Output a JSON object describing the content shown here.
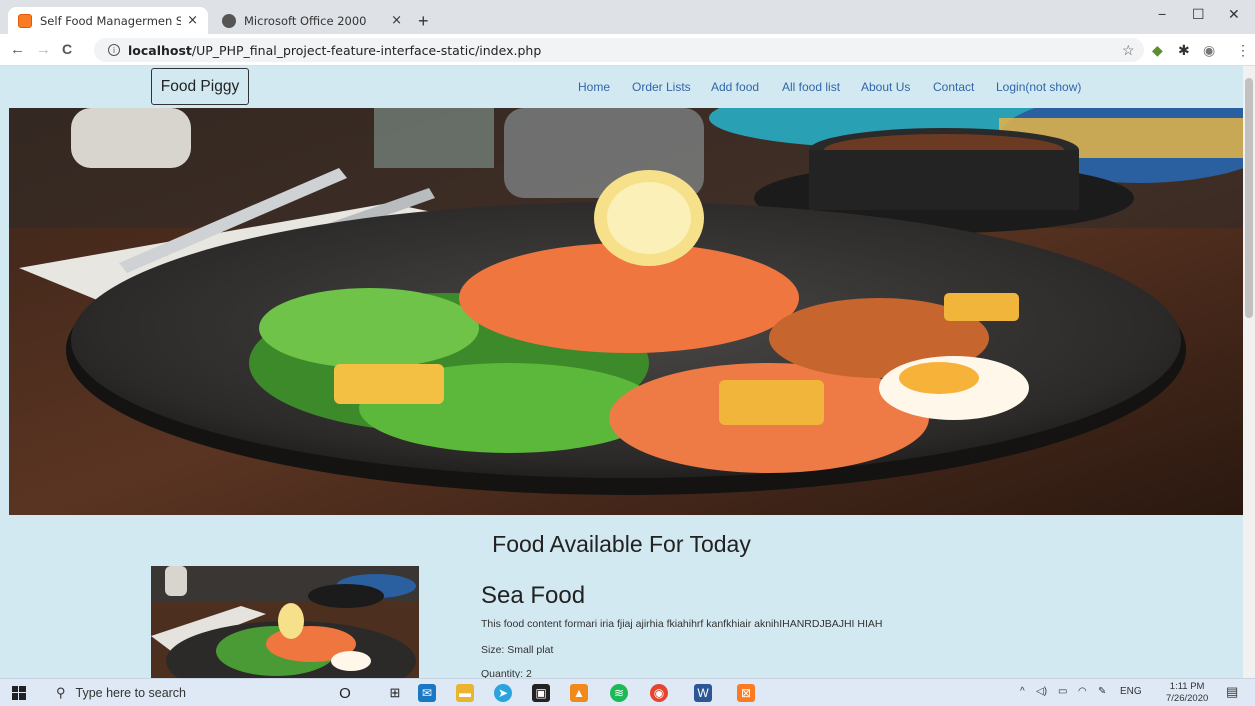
{
  "browser": {
    "tabs": [
      {
        "title": "Self Food Managermen System",
        "close": "×"
      },
      {
        "title": "Microsoft Office 2000",
        "close": "×"
      }
    ],
    "new_tab": "+",
    "window_controls": {
      "minimize": "−",
      "maximize": "☐",
      "close": "✕"
    },
    "nav": {
      "back": "←",
      "forward": "→",
      "reload": "C"
    },
    "url_host": "localhost",
    "url_path": "/UP_PHP_final_project-feature-interface-static/index.php",
    "info_icon": "i"
  },
  "site": {
    "brand": "Food Piggy",
    "nav": [
      "Home",
      "Order Lists",
      "Add food",
      "All food list",
      "About Us",
      "Contact",
      "Login(not show)"
    ],
    "section_title": "Food Available For Today",
    "food": {
      "name": "Sea Food",
      "description": "This food content formari iria fjiaj ajirhia fkiahihrf kanfkhiair aknihIHANRDJBAJHI HIAH",
      "size": "Size: Small plat",
      "quantity": "Quantity: 2"
    }
  },
  "taskbar": {
    "search_placeholder": "Type here to search",
    "tray_lang": "ENG",
    "time": "1:11 PM",
    "date": "7/26/2020"
  },
  "colors": {
    "page_bg": "#d3e9f1",
    "nav_link": "#3166a8",
    "taskbar_bg": "#dfe9f5"
  }
}
